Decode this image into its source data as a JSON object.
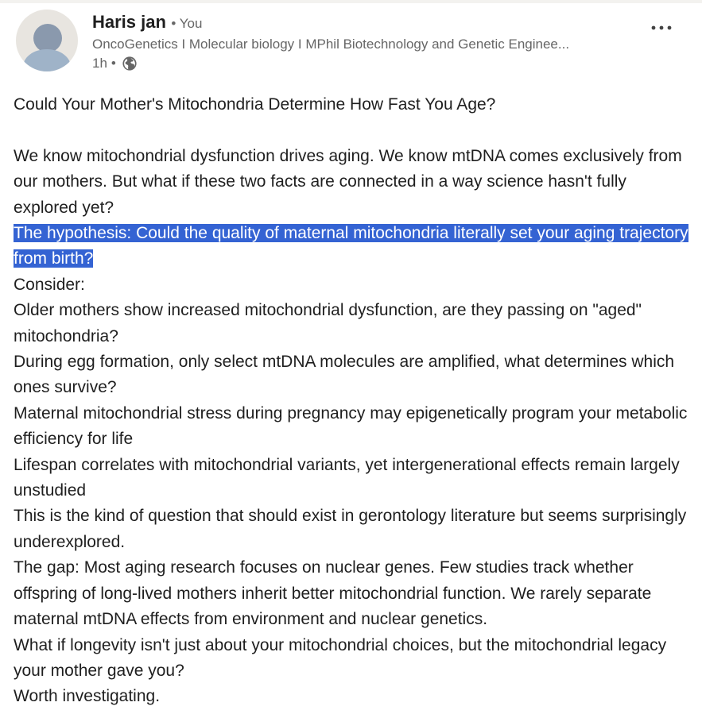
{
  "author": {
    "name": "Haris jan",
    "degree": "• You",
    "headline": "OncoGenetics I Molecular biology I MPhil Biotechnology and Genetic Enginee...",
    "time": "1h",
    "separator": "•",
    "visibility_icon": "globe-icon"
  },
  "more_icon": "three-dots-icon",
  "post": {
    "title": "Could Your Mother's Mitochondria Determine How Fast You Age?",
    "intro": "We know mitochondrial dysfunction drives aging. We know mtDNA comes exclusively from our mothers. But what if these two facts are connected in a way science hasn't fully explored yet?",
    "hypothesis": "The hypothesis: Could the quality of maternal mitochondria literally set your aging trajectory from birth?",
    "consider": "Consider:",
    "points": [
      "Older mothers show increased mitochondrial dysfunction, are they passing on \"aged\" mitochondria?",
      "During egg formation, only select mtDNA molecules are amplified, what determines which ones survive?",
      "Maternal mitochondrial stress during pregnancy may epigenetically program your metabolic efficiency for life",
      "Lifespan correlates with mitochondrial variants, yet intergenerational effects remain largely unstudied"
    ],
    "remark": "This is the kind of question that should exist in gerontology literature but seems surprisingly underexplored.",
    "gap": "The gap: Most aging research focuses on nuclear genes. Few studies track whether offspring of long-lived mothers inherit better mitochondrial function. We rarely separate maternal mtDNA effects from environment and nuclear genetics.",
    "question": "What if longevity isn't just about your mitochondrial choices, but the mitochondrial legacy your mother gave you?",
    "closing": "Worth investigating."
  },
  "colors": {
    "highlight": "#3463d3",
    "muted_text": "#666666",
    "body_text": "#1f1f1f"
  }
}
